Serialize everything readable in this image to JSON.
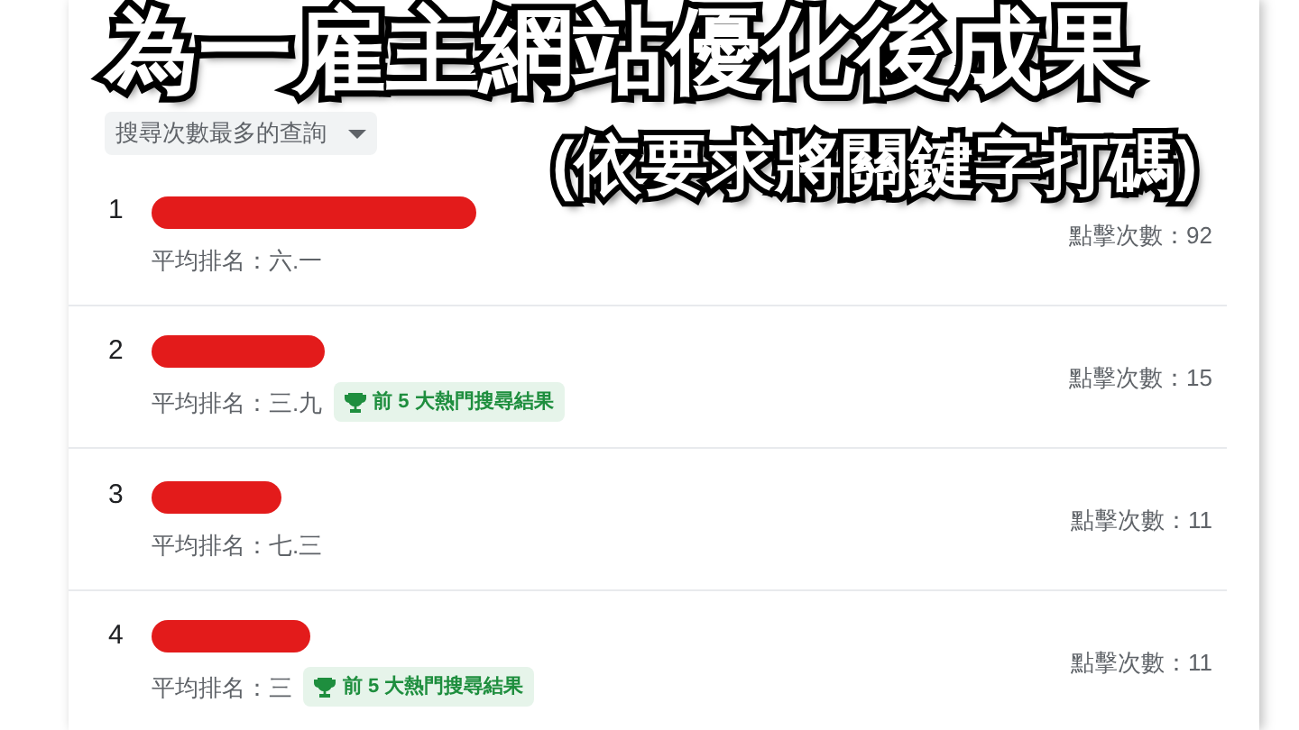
{
  "overlay_title": "為一雇主網站優化後成果",
  "overlay_subtitle": "(依要求將關鍵字打碼)",
  "sort_dropdown": {
    "label": "搜尋次數最多的查詢"
  },
  "queries": [
    {
      "rank": "1",
      "redacted": true,
      "position": "平均排名：六.一",
      "clicks": "點擊次數：92"
    },
    {
      "rank": "2",
      "redacted": true,
      "position": "平均排名：三.九",
      "badge": "前 5 大熱門搜尋結果",
      "clicks": "點擊次數：15"
    },
    {
      "rank": "3",
      "redacted": true,
      "position": "平均排名：七.三",
      "clicks": "點擊次數：11"
    },
    {
      "rank": "4",
      "redacted": true,
      "position": "平均排名：三",
      "badge": "前 5 大熱門搜尋結果",
      "clicks": "點擊次數：11"
    }
  ]
}
